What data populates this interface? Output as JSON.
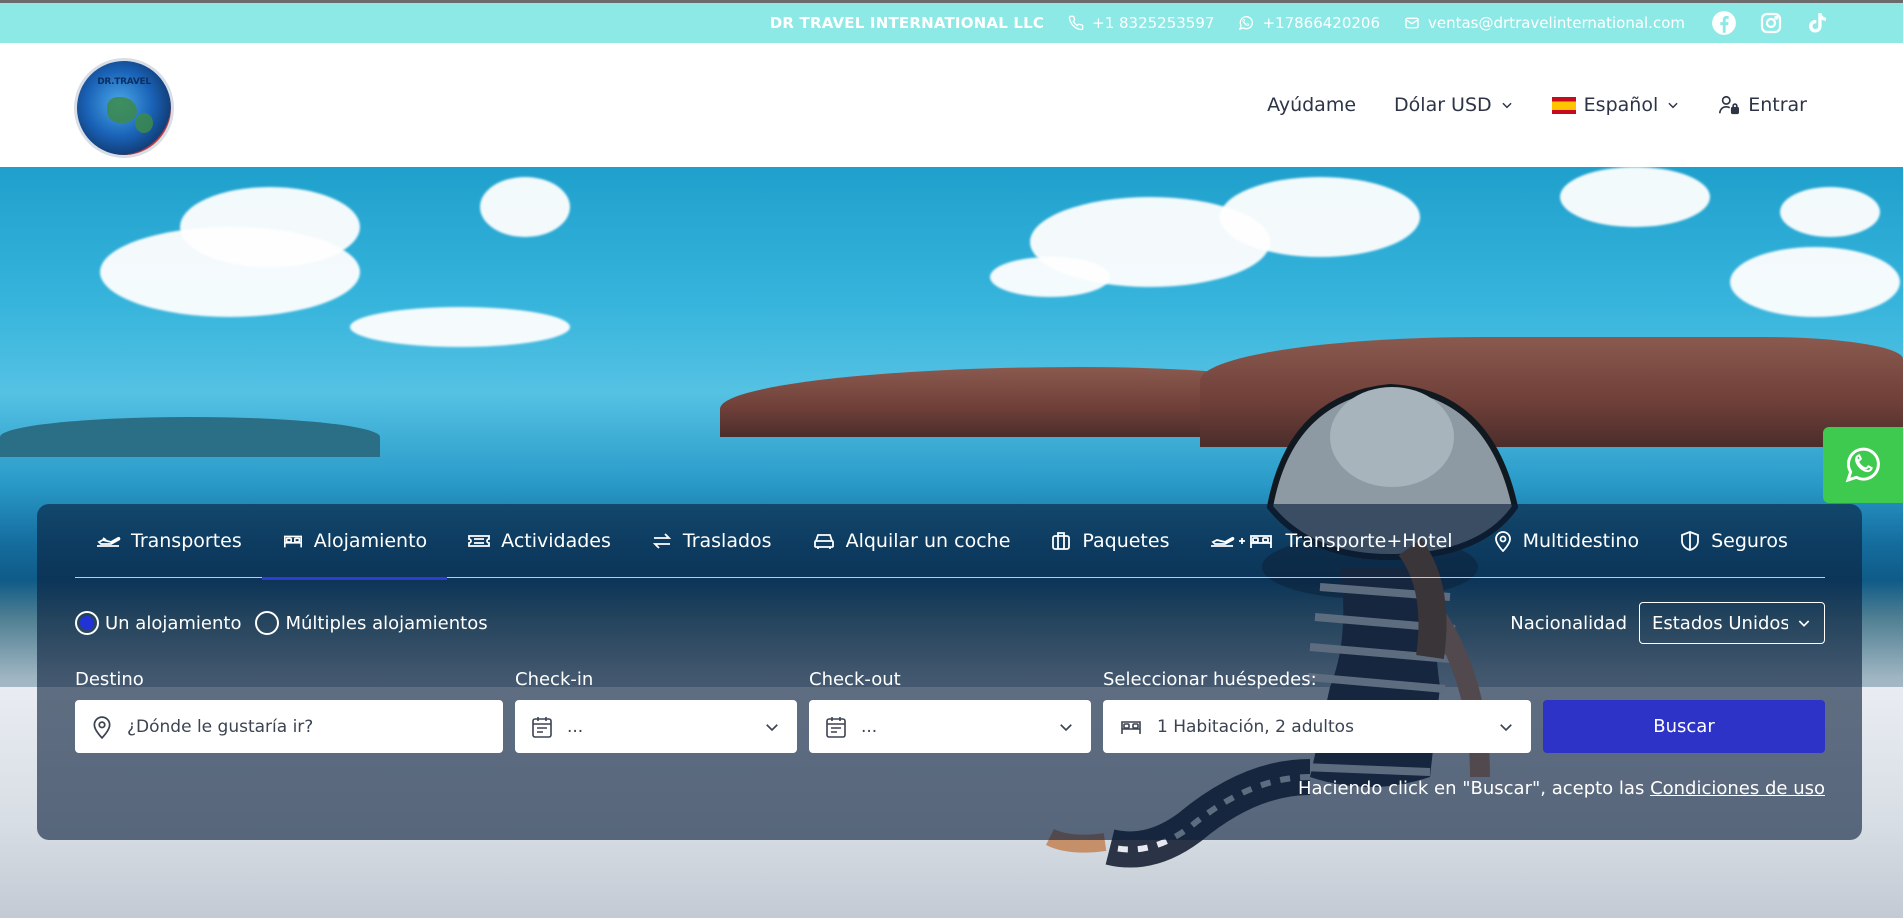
{
  "topbar": {
    "company": "DR TRAVEL INTERNATIONAL LLC",
    "phone": "+1 8325253597",
    "whatsapp": "+17866420206",
    "email": "ventas@drtravelinternational.com",
    "social_icons": [
      "facebook-icon",
      "instagram-icon",
      "tiktok-icon"
    ],
    "bg_color": "#8de9e5"
  },
  "header": {
    "logo_text": "DR.TRAVEL",
    "help": "Ayúdame",
    "currency": "Dólar USD",
    "language": "Español",
    "login": "Entrar"
  },
  "search": {
    "tabs": [
      {
        "label": "Transportes",
        "icon": "plane-icon",
        "active": false
      },
      {
        "label": "Alojamiento",
        "icon": "bed-icon",
        "active": true
      },
      {
        "label": "Actividades",
        "icon": "ticket-icon",
        "active": false
      },
      {
        "label": "Traslados",
        "icon": "transfer-arrows-icon",
        "active": false
      },
      {
        "label": "Alquilar un coche",
        "icon": "car-icon",
        "active": false
      },
      {
        "label": "Paquetes",
        "icon": "suitcase-icon",
        "active": false
      },
      {
        "label": "Transporte+Hotel",
        "icon": "plane-plus-bed-icon",
        "active": false
      },
      {
        "label": "Multidestino",
        "icon": "map-pin-icon",
        "active": false
      },
      {
        "label": "Seguros",
        "icon": "shield-icon",
        "active": false
      }
    ],
    "mode_options": [
      {
        "label": "Un alojamiento",
        "selected": true
      },
      {
        "label": "Múltiples alojamientos",
        "selected": false
      }
    ],
    "nationality_label": "Nacionalidad",
    "nationality_value": "Estados Unidos",
    "destination_label": "Destino",
    "destination_placeholder": "¿Dónde le gustaría ir?",
    "checkin_label": "Check-in",
    "checkin_value": "...",
    "checkout_label": "Check-out",
    "checkout_value": "...",
    "guests_label": "Seleccionar huéspedes:",
    "guests_value": "1 Habitación, 2 adultos",
    "search_button": "Buscar",
    "legal_text": "Haciendo click en \"Buscar\", acepto las",
    "legal_link": "Condiciones de uso",
    "accent_color": "#2c33c6"
  },
  "whatsapp_button": {
    "icon": "whatsapp-icon",
    "color": "#3ec94f"
  }
}
